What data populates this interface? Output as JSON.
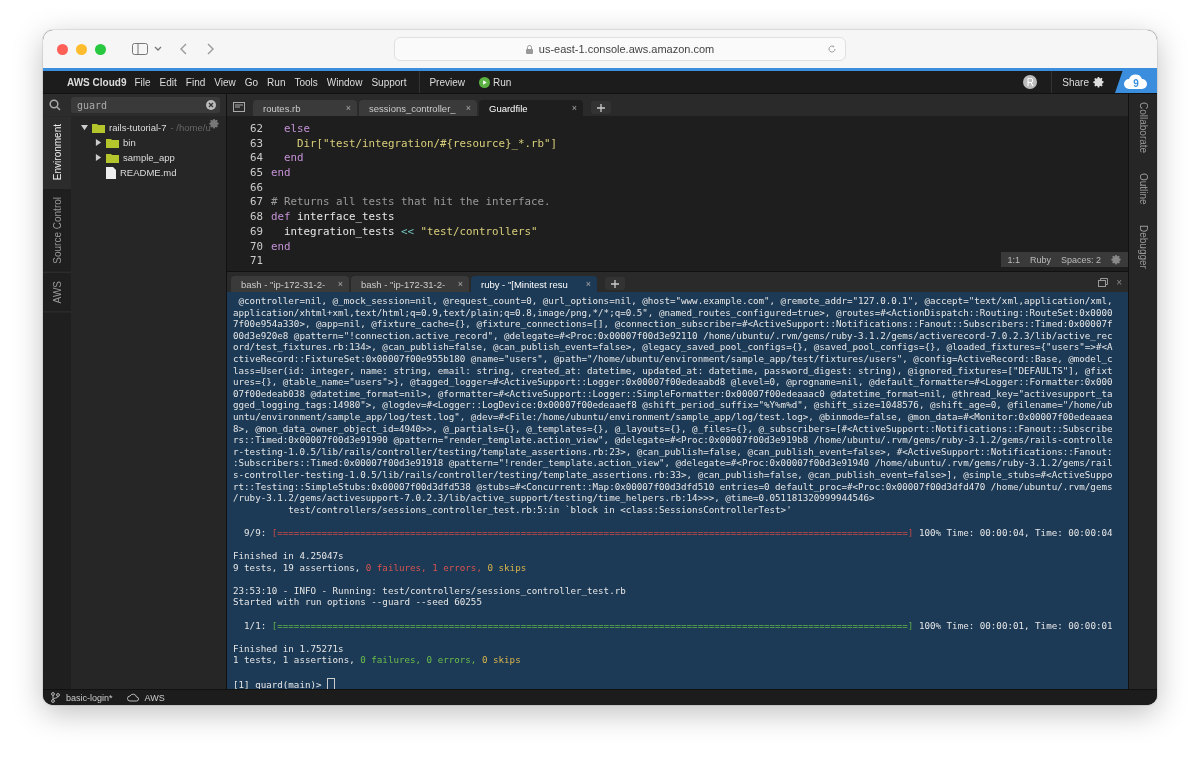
{
  "browser": {
    "url": "us-east-1.console.aws.amazon.com"
  },
  "menubar": {
    "brand": "AWS Cloud9",
    "items": [
      "File",
      "Edit",
      "Find",
      "View",
      "Go",
      "Run",
      "Tools",
      "Window",
      "Support"
    ],
    "actions": [
      {
        "label": "Preview",
        "kind": "plain"
      },
      {
        "label": "Run",
        "kind": "run"
      }
    ],
    "avatar": "R",
    "share": "Share",
    "logo": "9"
  },
  "search": {
    "value": "guard"
  },
  "left_rail": [
    {
      "label": "Environment",
      "selected": true
    },
    {
      "label": "Source Control",
      "selected": false
    },
    {
      "label": "AWS",
      "selected": false
    }
  ],
  "tree": [
    {
      "name": "rails-tutorial-7",
      "path": " - /home/u",
      "kind": "folder",
      "expanded": true,
      "children": [
        {
          "name": "bin",
          "kind": "folder",
          "expanded": false
        },
        {
          "name": "sample_app",
          "kind": "folder",
          "expanded": false
        },
        {
          "name": "README.md",
          "kind": "file"
        }
      ]
    }
  ],
  "editor_tabs": [
    {
      "label": "routes.rb",
      "close": "×",
      "selected": false
    },
    {
      "label": "sessions_controller_",
      "close": "×",
      "selected": false
    },
    {
      "label": "Guardfile",
      "close": "×",
      "selected": true
    }
  ],
  "code": [
    {
      "n": "62",
      "tokens": [
        {
          "t": "  else",
          "kind": "keyword"
        }
      ]
    },
    {
      "n": "63",
      "tokens": [
        {
          "t": "    Dir[\"test/integration/#{resource}_*.rb\"]",
          "kind": "string"
        }
      ]
    },
    {
      "n": "64",
      "tokens": [
        {
          "t": "  end",
          "kind": "keyword"
        }
      ]
    },
    {
      "n": "65",
      "tokens": [
        {
          "t": "end",
          "kind": "keyword"
        }
      ]
    },
    {
      "n": "66"
    },
    {
      "n": "67",
      "tokens": [
        {
          "t": "# Returns all tests that hit the interface.",
          "kind": "comment"
        }
      ]
    },
    {
      "n": "68",
      "tokens": [
        {
          "t": "def",
          "kind": "keyword"
        },
        {
          "t": " interface_tests",
          "kind": "plain"
        }
      ]
    },
    {
      "n": "69",
      "tokens": [
        {
          "t": "  integration_tests ",
          "kind": "plain"
        },
        {
          "t": "<<",
          "kind": "operator"
        },
        {
          "t": " \"test/controllers\"",
          "kind": "string"
        }
      ]
    },
    {
      "n": "70",
      "tokens": [
        {
          "t": "end",
          "kind": "keyword"
        }
      ]
    },
    {
      "n": "71"
    }
  ],
  "editor_status": {
    "position": "1:1",
    "language": "Ruby",
    "indent": "Spaces: 2"
  },
  "terminal_tabs": [
    {
      "label": "bash - \"ip-172-31-2-",
      "close": "×",
      "selected": false
    },
    {
      "label": "bash - \"ip-172-31-2-",
      "close": "×",
      "selected": false
    },
    {
      "label": "ruby - \"[Minitest resu",
      "close": "×",
      "selected": true
    }
  ],
  "terminal_close": "×",
  "terminal": [
    {
      "kind": "text",
      "text": " @controller=nil, @_mock_session=nil, @request_count=0, @url_options=nil, @host=\"www.example.com\", @remote_addr=\"127.0.0.1\", @accept=\"text/xml,application/xml,"
    },
    {
      "kind": "text",
      "text": "application/xhtml+xml,text/html;q=0.9,text/plain;q=0.8,image/png,*/*;q=0.5\", @named_routes_configured=true>, @routes=#<ActionDispatch::Routing::RouteSet:0x0000"
    },
    {
      "kind": "text",
      "text": "7f00e954a330>, @app=nil, @fixture_cache={}, @fixture_connections=[], @connection_subscriber=#<ActiveSupport::Notifications::Fanout::Subscribers::Timed:0x00007f"
    },
    {
      "kind": "text",
      "text": "00d3e920e8 @pattern=\"!connection.active_record\", @delegate=#<Proc:0x00007f00d3e92110 /home/ubuntu/.rvm/gems/ruby-3.1.2/gems/activerecord-7.0.2.3/lib/active_rec"
    },
    {
      "kind": "text",
      "text": "ord/test_fixtures.rb:134>, @can_publish=false, @can_publish_event=false>, @legacy_saved_pool_configs={}, @saved_pool_configs={}, @loaded_fixtures={\"users\"=>#<A"
    },
    {
      "kind": "text",
      "text": "ctiveRecord::FixtureSet:0x00007f00e955b180 @name=\"users\", @path=\"/home/ubuntu/environment/sample_app/test/fixtures/users\", @config=ActiveRecord::Base, @model_c"
    },
    {
      "kind": "text",
      "text": "lass=User(id: integer, name: string, email: string, created_at: datetime, updated_at: datetime, password_digest: string), @ignored_fixtures=[\"DEFAULTS\"], @fixt"
    },
    {
      "kind": "text",
      "text": "ures={}, @table_name=\"users\">}, @tagged_logger=#<ActiveSupport::Logger:0x00007f00edeaabd8 @level=0, @progname=nil, @default_formatter=#<Logger::Formatter:0x000"
    },
    {
      "kind": "text",
      "text": "07f00edeab038 @datetime_format=nil>, @formatter=#<ActiveSupport::Logger::SimpleFormatter:0x00007f00edeaaac0 @datetime_format=nil, @thread_key=\"activesupport_ta"
    },
    {
      "kind": "text",
      "text": "gged_logging_tags:14980\">, @logdev=#<Logger::LogDevice:0x00007f00edeaaef8 @shift_period_suffix=\"%Y%m%d\", @shift_size=1048576, @shift_age=0, @filename=\"/home/ub"
    },
    {
      "kind": "text",
      "text": "untu/environment/sample_app/log/test.log\", @dev=#<File:/home/ubuntu/environment/sample_app/log/test.log>, @binmode=false, @mon_data=#<Monitor:0x00007f00edeaaea"
    },
    {
      "kind": "text",
      "text": "8>, @mon_data_owner_object_id=4940>>, @_partials={}, @_templates={}, @_layouts={}, @_files={}, @_subscribers=[#<ActiveSupport::Notifications::Fanout::Subscribe"
    },
    {
      "kind": "text",
      "text": "rs::Timed:0x00007f00d3e91990 @pattern=\"render_template.action_view\", @delegate=#<Proc:0x00007f00d3e919b8 /home/ubuntu/.rvm/gems/ruby-3.1.2/gems/rails-controlle"
    },
    {
      "kind": "text",
      "text": "r-testing-1.0.5/lib/rails/controller/testing/template_assertions.rb:23>, @can_publish=false, @can_publish_event=false>, #<ActiveSupport::Notifications::Fanout:"
    },
    {
      "kind": "text",
      "text": ":Subscribers::Timed:0x00007f00d3e91918 @pattern=\"!render_template.action_view\", @delegate=#<Proc:0x00007f00d3e91940 /home/ubuntu/.rvm/gems/ruby-3.1.2/gems/rail"
    },
    {
      "kind": "text",
      "text": "s-controller-testing-1.0.5/lib/rails/controller/testing/template_assertions.rb:33>, @can_publish=false, @can_publish_event=false>], @simple_stubs=#<ActiveSuppo"
    },
    {
      "kind": "text",
      "text": "rt::Testing::SimpleStubs:0x00007f00d3dfd538 @stubs=#<Concurrent::Map:0x00007f00d3dfd510 entries=0 default_proc=#<Proc:0x00007f00d3dfd470 /home/ubuntu/.rvm/gems"
    },
    {
      "kind": "text",
      "text": "/ruby-3.1.2/gems/activesupport-7.0.2.3/lib/active_support/testing/time_helpers.rb:14>>>, @time=0.051181320999944546>"
    },
    {
      "kind": "text",
      "text": "          test/controllers/sessions_controller_test.rb:5:in `block in <class:SessionsControllerTest>'"
    },
    {
      "kind": "blank"
    },
    {
      "kind": "failbar",
      "label": "  9/9: ",
      "bar": "[==================================================================================================================]",
      "suffix": " 100% Time: 00:00:04, Time: 00:00:04"
    },
    {
      "kind": "blank"
    },
    {
      "kind": "text",
      "text": "Finished in 4.25047s"
    },
    {
      "kind": "parts",
      "parts": [
        {
          "text": "9 tests, 19 assertions, ",
          "kind": "plain"
        },
        {
          "text": "0 failures, 1 errors, ",
          "kind": "failure"
        },
        {
          "text": "0 skips",
          "kind": "skip"
        }
      ]
    },
    {
      "kind": "blank"
    },
    {
      "kind": "text",
      "text": "23:53:10 - INFO - Running: test/controllers/sessions_controller_test.rb"
    },
    {
      "kind": "text",
      "text": "Started with run options --guard --seed 60255"
    },
    {
      "kind": "blank"
    },
    {
      "kind": "passbar",
      "label": "  1/1: ",
      "bar": "[==================================================================================================================]",
      "suffix": " 100% Time: 00:00:01, Time: 00:00:01"
    },
    {
      "kind": "blank"
    },
    {
      "kind": "text",
      "text": "Finished in 1.75271s"
    },
    {
      "kind": "parts",
      "parts": [
        {
          "text": "1 tests, 1 assertions, ",
          "kind": "plain"
        },
        {
          "text": "0 failures, 0 errors, ",
          "kind": "success"
        },
        {
          "text": "0 skips",
          "kind": "skip"
        }
      ]
    },
    {
      "kind": "blank"
    },
    {
      "kind": "prompt",
      "text": "[1] guard(main)> "
    }
  ],
  "right_rail": [
    "Collaborate",
    "Outline",
    "Debugger"
  ],
  "status_bar": {
    "branch": "basic-login*",
    "region": "AWS"
  }
}
